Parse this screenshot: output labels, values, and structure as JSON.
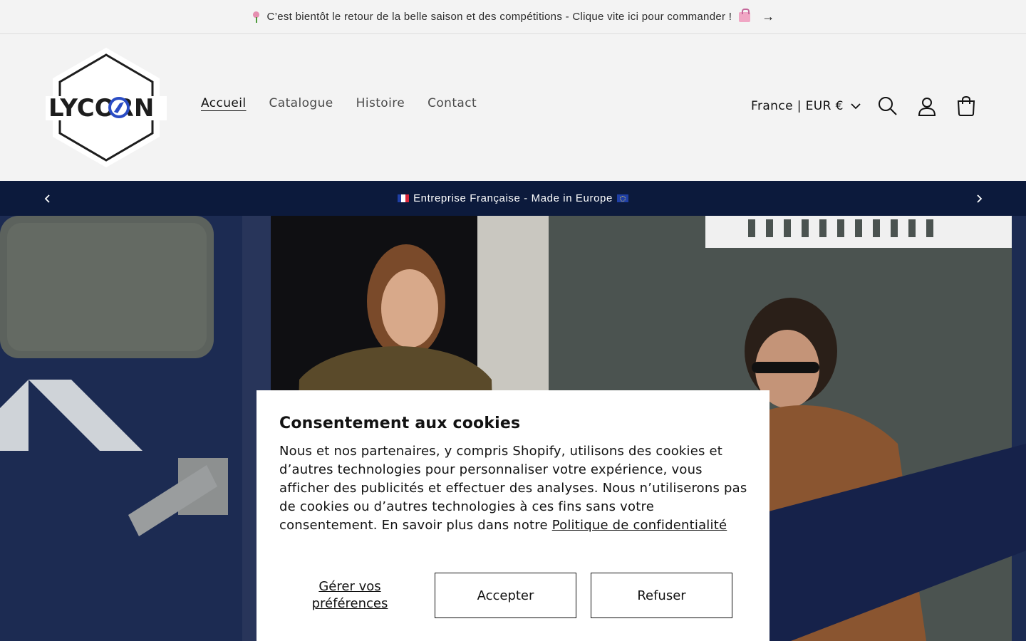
{
  "announcement": {
    "text": "C’est bientôt le retour de la belle saison et des compétitions - Clique vite ici pour commander !",
    "icon_left": "tulip-emoji",
    "icon_right": "shopping-bags-emoji",
    "arrow": "→"
  },
  "header": {
    "logo_text": "LYCORN",
    "nav": [
      {
        "label": "Accueil",
        "active": true
      },
      {
        "label": "Catalogue",
        "active": false
      },
      {
        "label": "Histoire",
        "active": false
      },
      {
        "label": "Contact",
        "active": false
      }
    ],
    "country_selector": "France | EUR €",
    "icons": [
      "search-icon",
      "account-icon",
      "cart-icon"
    ]
  },
  "strip": {
    "text": "Entreprise Française - Made in Europe",
    "icon_left": "france-flag-emoji",
    "icon_right": "eu-flag-emoji"
  },
  "cookie": {
    "title": "Consentement aux cookies",
    "body": "Nous et nos partenaires, y compris Shopify, utilisons des cookies et d’autres technologies pour personnaliser votre expérience, vous afficher des publicités et effectuer des analyses. Nous n’utiliserons pas de cookies ou d’autres technologies à ces fins sans votre consentement. En savoir plus dans notre ",
    "policy_link": "Politique de confidentialité",
    "manage_label": "Gérer vos préférences",
    "accept_label": "Accepter",
    "refuse_label": "Refuser"
  },
  "colors": {
    "strip_bg": "#0c1a3c",
    "page_bg": "#f3f3f3",
    "text": "#121212"
  }
}
